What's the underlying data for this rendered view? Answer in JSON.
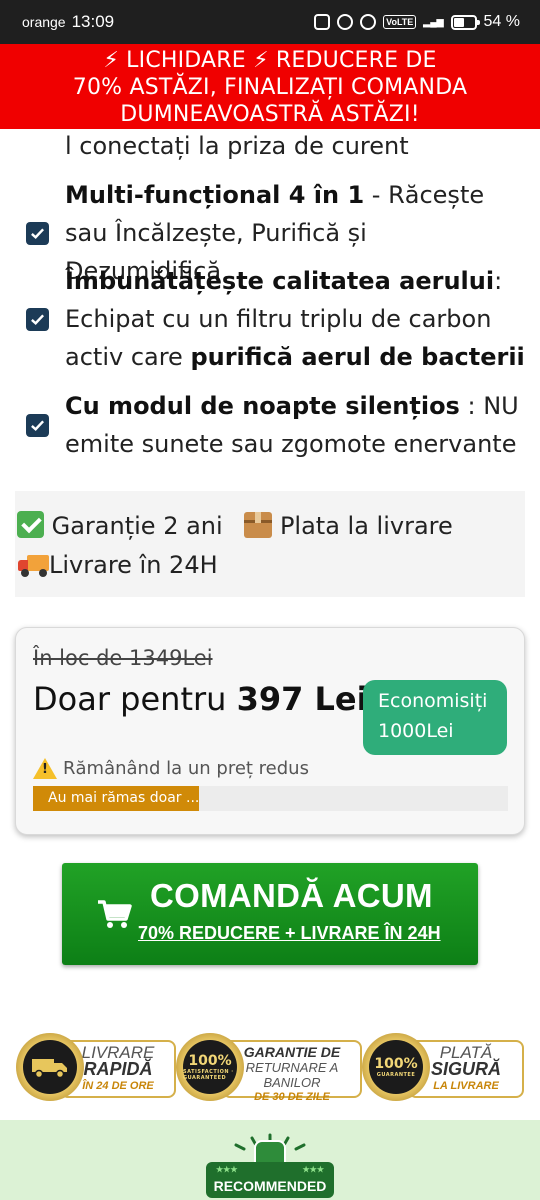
{
  "status_bar": {
    "carrier": "orange",
    "time": "13:09",
    "battery": "54 %",
    "battery_level": 0.54,
    "network": "VoLTE"
  },
  "banner": {
    "line1": "⚡ LICHIDARE ⚡ REDUCERE DE",
    "line2": "70% ASTĂZI, FINALIZAȚI COMANDA",
    "line3": "DUMNEAVOASTRĂ ASTĂZI!"
  },
  "features": {
    "partial_line": "l conectați la priza de curent",
    "items": [
      {
        "bold": "Multi-funcțional 4 în 1",
        "text": " - Răcește sau Încălzește, Purifică și Dezumidifică"
      },
      {
        "bold": "Îmbunătățește calitatea aerului",
        "text": ": Echipat cu un filtru triplu de carbon activ care ",
        "bold2": "purifică aerul de bacterii"
      },
      {
        "bold": "Cu modul de noapte silențios",
        "text": " : NU emite sunete sau zgomote enervante"
      }
    ]
  },
  "guarantee": {
    "warranty": " Garanție 2 ani",
    "payment": " Plata la livrare",
    "delivery": "Livrare în 24H"
  },
  "price": {
    "old": "În loc de 1349Lei",
    "now_prefix": "Doar pentru ",
    "now_value": "397 Lei",
    "save_line1": "Economisiți",
    "save_line2": "1000Lei",
    "warning": "Rămânând la un preț redus",
    "stock_label": "Au mai rămas doar ...",
    "stock_fraction": 0.35
  },
  "cta": {
    "main": "COMANDĂ ACUM",
    "sub": "70% REDUCERE + LIVRARE ÎN 24H"
  },
  "trust": {
    "delivery": {
      "l1": "LIVRARE",
      "l2": "RAPIDĂ",
      "l3": "ÎN 24 DE ORE"
    },
    "returns": {
      "l1": "GARANTIE DE",
      "l2": "RETURNARE A",
      "l3": "BANILOR",
      "l4": "DE 30 DE ZILE",
      "seal": "100%",
      "seal_ring": "SATISFACTION · GUARANTEED"
    },
    "payment": {
      "l1": "PLATĂ",
      "l2": "SIGURĂ",
      "l3": "LA LIVRARE",
      "seal": "100%",
      "seal_ring": "GUARANTEE"
    }
  },
  "recommended": {
    "label": "RECOMMENDED",
    "stars": "★★★"
  }
}
